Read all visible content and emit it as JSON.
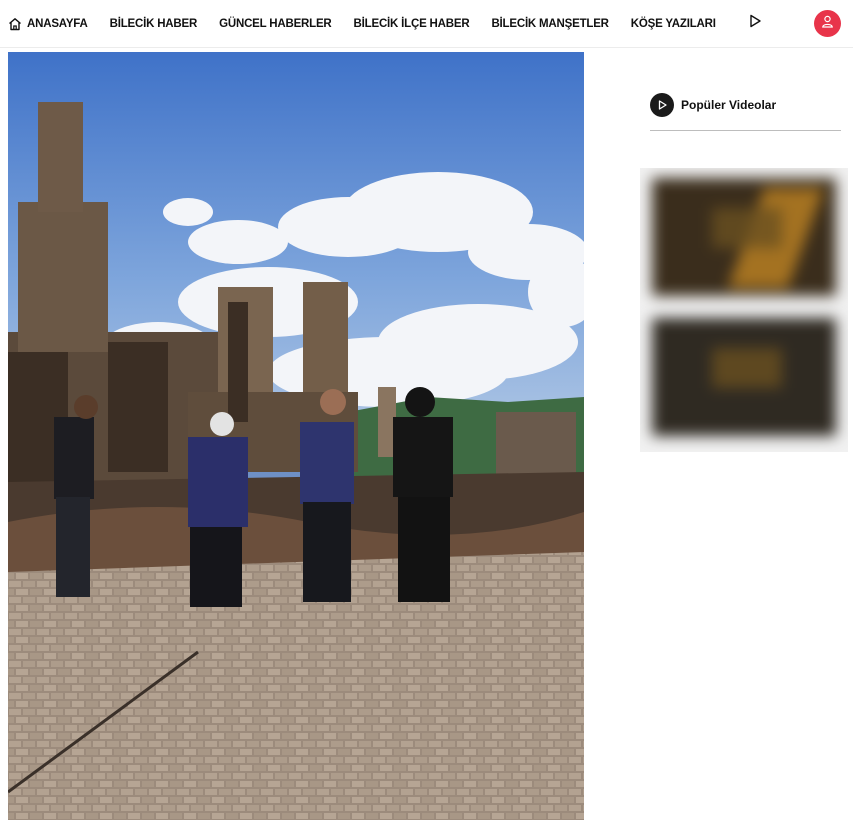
{
  "nav": {
    "items": [
      {
        "label": "ANASAYFA",
        "icon": "home-icon"
      },
      {
        "label": "BİLECİK HABER"
      },
      {
        "label": "GÜNCEL HABERLER"
      },
      {
        "label": "BİLECİK İLÇE HABER"
      },
      {
        "label": "BİLECİK MANŞETLER"
      },
      {
        "label": "KÖŞE YAZILARI"
      }
    ],
    "more_icon": "play-outline-icon",
    "user_icon": "user-icon",
    "user_button_color": "#e8344a"
  },
  "hero": {
    "image_icon": "news-photo"
  },
  "sidebar": {
    "popular_videos_title": "Popüler Videolar",
    "popular_videos_icon": "play-circle-icon"
  },
  "colors": {
    "accent": "#e8344a",
    "text": "#111111"
  }
}
